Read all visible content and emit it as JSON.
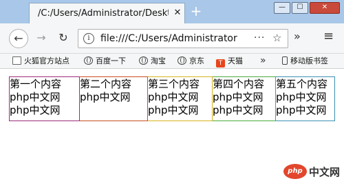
{
  "browser": {
    "tab": {
      "title": "/C:/Users/Administrator/Desktop",
      "close": "✕"
    },
    "new_tab": "+",
    "window_controls": {
      "minimize": "—",
      "maximize": "☐",
      "close": "✕"
    },
    "nav": {
      "back": "←",
      "forward": "→",
      "reload": "↻",
      "url": "file:///C:/Users/Administrator",
      "url_more": "···",
      "bookmark_star": "☆",
      "overflow": "»",
      "menu": "≡"
    },
    "bookmarks": {
      "items": [
        {
          "label": "火狐官方站点",
          "icon": "folder-icon"
        },
        {
          "label": "百度一下",
          "icon": "globe-icon"
        },
        {
          "label": "淘宝",
          "icon": "globe-icon"
        },
        {
          "label": "京东",
          "icon": "globe-icon"
        },
        {
          "label": "天猫",
          "icon": "tmall-icon"
        }
      ],
      "more": "»",
      "mobile": {
        "label": "移动版书签",
        "icon": "phone-icon"
      }
    }
  },
  "page": {
    "boxes": [
      {
        "lines": [
          "第一个内容",
          "php中文网",
          "php中文网"
        ],
        "border": "#9b2a7a"
      },
      {
        "lines": [
          "第二个内容",
          "php中文网",
          ""
        ],
        "border": "#c94b1f"
      },
      {
        "lines": [
          "第三个内容",
          "php中文网",
          "php中文网"
        ],
        "border": "#d6b21b"
      },
      {
        "lines": [
          "第四个内容",
          "php中文网",
          "php中文网"
        ],
        "border": "#4aaa3a"
      },
      {
        "lines": [
          "第五个内容",
          "php中文网",
          "php中文网"
        ],
        "border": "#3a8fb0"
      }
    ]
  },
  "watermark": {
    "badge": "php",
    "text": "中文网"
  }
}
